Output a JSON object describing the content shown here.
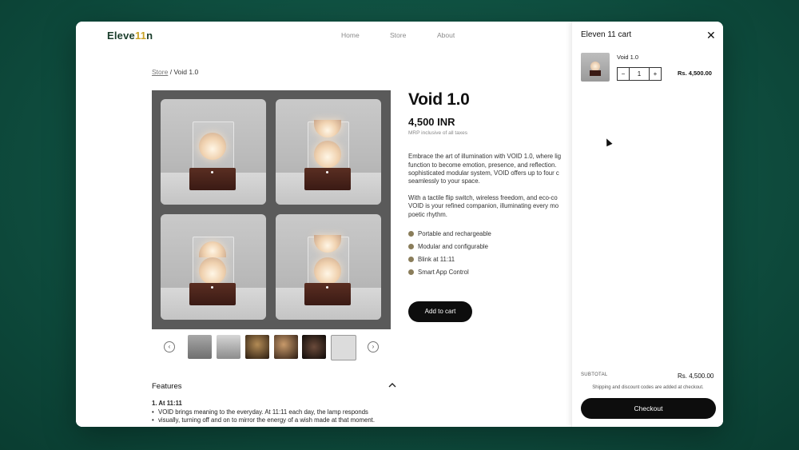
{
  "site": {
    "logo_main": "Eleve",
    "logo_accent": "11",
    "logo_end": "n",
    "nav": [
      "Home",
      "Store",
      "About"
    ]
  },
  "breadcrumb": {
    "parent": "Store",
    "separator": "/",
    "current": "Void 1.0"
  },
  "product": {
    "title": "Void 1.0",
    "price": "4,500 INR",
    "mrp_note": "MRP inclusive of all taxes",
    "description": [
      "Embrace the art of illumination with VOID 1.0, where lig",
      "function to become emotion, presence, and reflection.",
      "sophisticated modular system, VOID offers up to four c",
      "seamlessly to your space.",
      "",
      "With a tactile flip switch, wireless freedom, and eco-co",
      "VOID is your refined companion, illuminating every mo",
      "poetic rhythm."
    ],
    "features_bullets": [
      "Portable and rechargeable",
      "Modular and configurable",
      "Blink at 11:11",
      "Smart App Control"
    ],
    "add_to_cart": "Add to cart"
  },
  "gallery": {
    "prev_icon": "‹",
    "next_icon": "›"
  },
  "features_section": {
    "heading": "Features",
    "item_title": "1. At 11:11",
    "lines": [
      "VOID brings meaning to the everyday. At 11:11 each day, the lamp responds",
      "visually, turning off and on to mirror the energy of a wish made at that moment."
    ]
  },
  "cart": {
    "title": "Eleven 11 cart",
    "close_icon": "✕",
    "item": {
      "name": "Void 1.0",
      "qty": "1",
      "minus": "−",
      "plus": "+",
      "price": "Rs. 4,500.00"
    },
    "subtotal_label": "SUBTOTAL",
    "subtotal_value": "Rs. 4,500.00",
    "shipping_note": "Shipping and discount codes are added at checkout.",
    "checkout": "Checkout"
  },
  "colors": {
    "background": "#0f4f40",
    "button": "#0d0d0d",
    "bullet_dot": "#8a7d5a",
    "logo_green": "#1a3d2b",
    "logo_gold": "#c9a227"
  }
}
